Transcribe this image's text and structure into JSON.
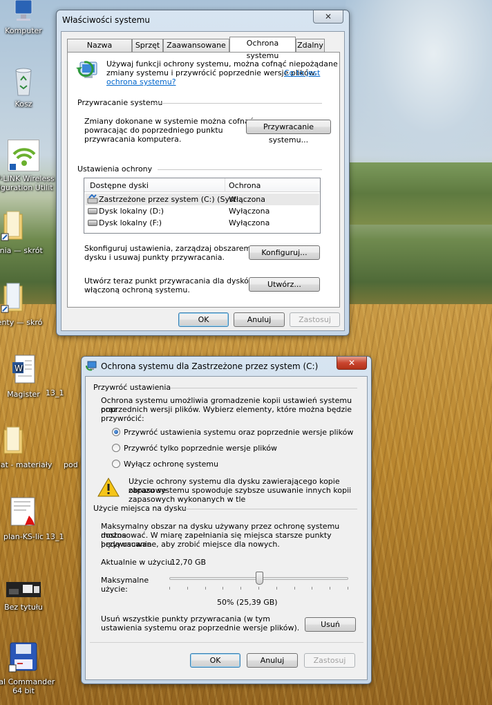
{
  "desktop": {
    "icons": [
      {
        "label": "Komputer",
        "icon": "computer-icon"
      },
      {
        "label": "Kosz",
        "icon": "recycle-bin-icon"
      },
      {
        "label": "P-LINK Wireless",
        "label2": "figuration Utilit",
        "icon": "wireless-utility-icon"
      },
      {
        "label": "czelnia — skrót",
        "icon": "folder-shortcut-icon"
      },
      {
        "label": "umenty — skró",
        "icon": "folder-shortcut-icon"
      },
      {
        "label": "Magister",
        "icon": "word-document-icon"
      },
      {
        "label": "13_1",
        "icon": "file-icon"
      },
      {
        "label": "encjat - materiały",
        "icon": "folder-icon"
      },
      {
        "label": "pod",
        "icon": "file-icon"
      },
      {
        "label": "plan-KS-lic",
        "icon": "pdf-icon"
      },
      {
        "label": "13_1",
        "icon": "file-icon"
      },
      {
        "label": "Bez tytułu",
        "icon": "image-icon"
      },
      {
        "label": "tal Commander",
        "label2": "64 bit",
        "icon": "total-commander-icon"
      }
    ]
  },
  "sysprops": {
    "title": "Właściwości systemu",
    "close": "✕",
    "tabs": [
      "Nazwa komputera",
      "Sprzęt",
      "Zaawansowane",
      "Ochrona systemu",
      "Zdalny"
    ],
    "intro": {
      "text1": "Używaj funkcji ochrony systemu, można cofnąć niepożądane",
      "text2": "zmiany systemu i przywrócić poprzednie wersje plików.",
      "link1": "Co to jest",
      "link2": "ochrona systemu?"
    },
    "restore": {
      "heading": "Przywracanie systemu",
      "line1": "Zmiany dokonane w systemie można cofnąć,",
      "line2": "powracając do poprzedniego punktu",
      "line3": "przywracania komputera.",
      "button": "Przywracanie systemu..."
    },
    "protection": {
      "heading": "Ustawienia ochrony",
      "col_drives": "Dostępne dyski",
      "col_protection": "Ochrona",
      "rows": [
        {
          "drive": "Zastrzeżone przez system (C:) (Syst...",
          "status": "Włączona"
        },
        {
          "drive": "Dysk lokalny (D:)",
          "status": "Wyłączona"
        },
        {
          "drive": "Dysk lokalny (F:)",
          "status": "Wyłączona"
        }
      ],
      "configure_line1": "Skonfiguruj ustawienia, zarządzaj obszarem",
      "configure_line2": "dysku i usuwaj punkty przywracania.",
      "configure_button": "Konfiguruj...",
      "create_line1": "Utwórz teraz punkt przywracania dla dysków z",
      "create_line2": "włączoną ochroną systemu.",
      "create_button": "Utwórz..."
    },
    "ok": "OK",
    "cancel": "Anuluj",
    "apply": "Zastosuj"
  },
  "protdlg": {
    "title": "Ochrona systemu dla Zastrzeżone przez system (C:)",
    "close": "✕",
    "restore_settings": {
      "heading": "Przywróć ustawienia",
      "line1": "Ochrona systemu umożliwia gromadzenie kopii ustawień systemu oraz",
      "line2": "poprzednich wersji plików. Wybierz elementy, które można będzie",
      "line3": "przywrócić:",
      "options": [
        "Przywróć ustawienia systemu oraz poprzednie wersje plików",
        "Przywróć tylko poprzednie wersje plików",
        "Wyłącz ochronę systemu"
      ],
      "selected_index": 0,
      "warning1": "Użycie ochrony systemu dla dysku zawierającego kopie zapasowe",
      "warning2": "obrazu systemu spowoduje szybsze usuwanie innych kopii",
      "warning3": "zapasowych wykonanych w tle"
    },
    "disk_usage": {
      "heading": "Użycie miejsca na dysku",
      "line1": "Maksymalny obszar na dysku używany przez ochronę systemu można",
      "line2": "dostosować. W miarę zapełniania się miejsca starsze punkty przywracania",
      "line3": "będą usuwane, aby zrobić miejsce dla nowych.",
      "current_label": "Aktualnie w użyciu:",
      "current_value": "12,70 GB",
      "max_label1": "Maksymalne",
      "max_label2": "użycie:",
      "slider_percent": 50,
      "slider_text": "50% (25,39 GB)",
      "delete_line1": "Usuń wszystkie punkty przywracania (w tym",
      "delete_line2": "ustawienia systemu oraz poprzednie wersje plików).",
      "delete_button": "Usuń"
    },
    "ok": "OK",
    "cancel": "Anuluj",
    "apply": "Zastosuj"
  }
}
